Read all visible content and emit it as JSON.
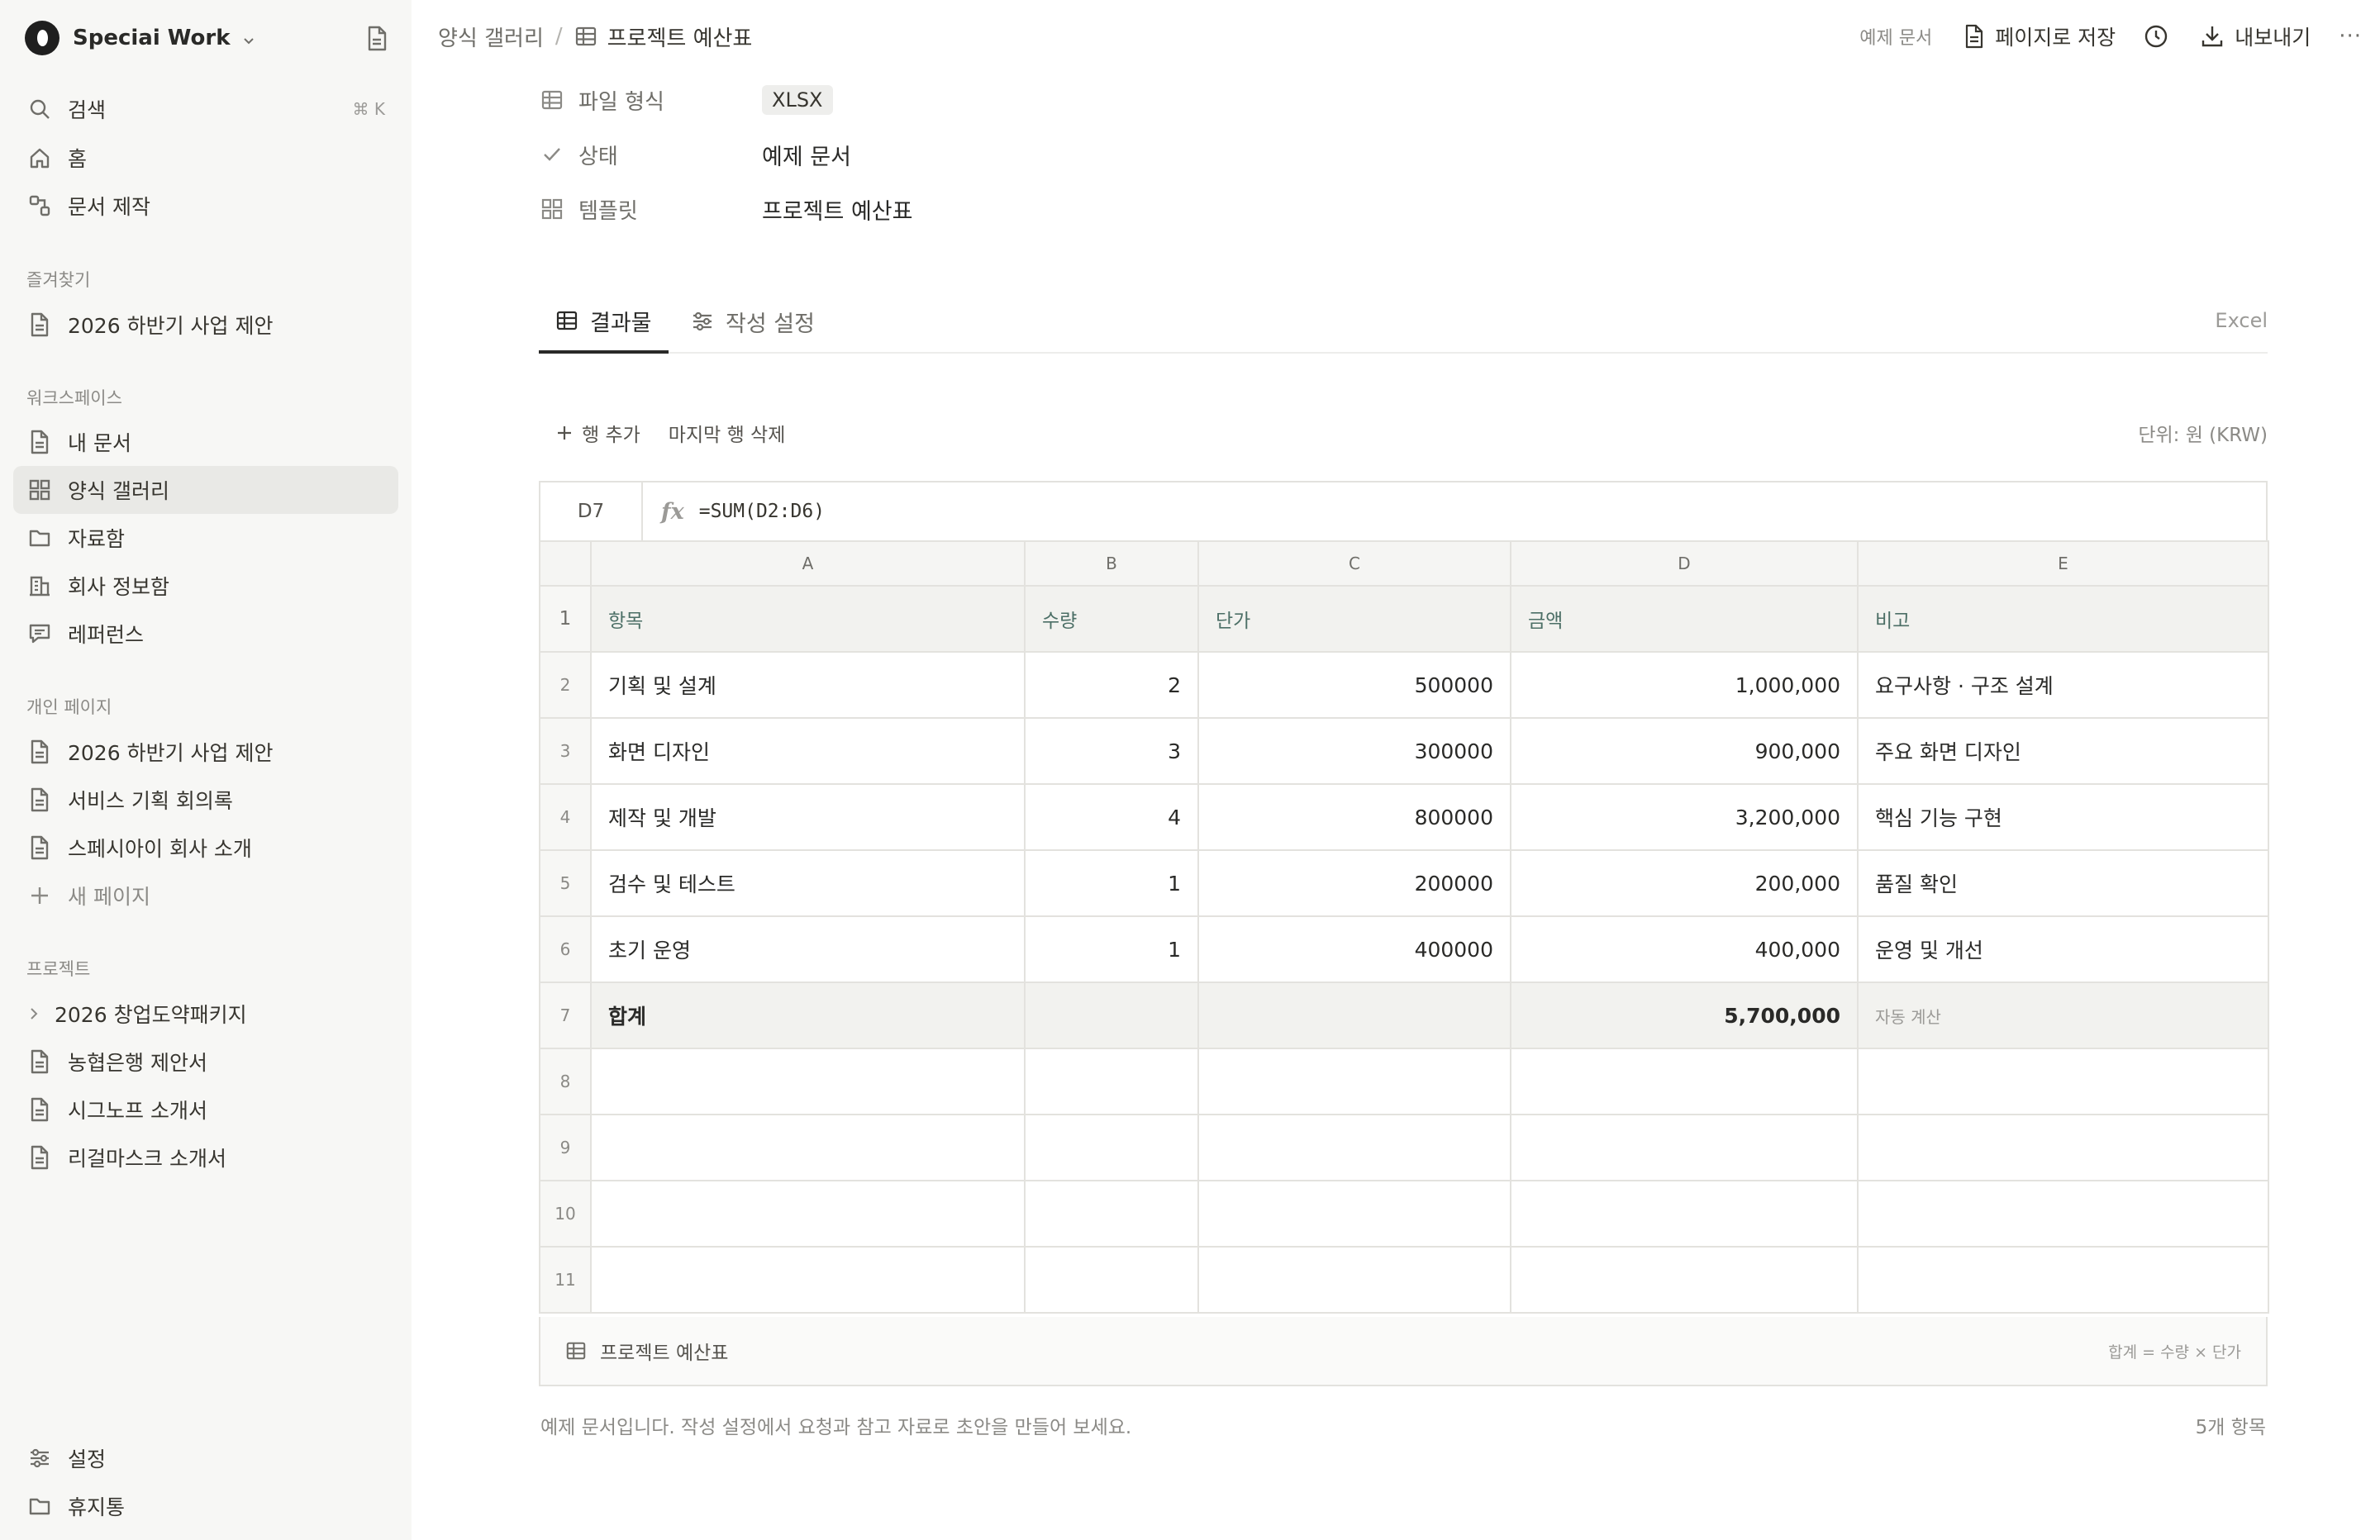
{
  "sidebar": {
    "workspace_name": "Speciai Work",
    "search": {
      "label": "검색",
      "shortcut": "⌘ K"
    },
    "top_items": [
      {
        "label": "홈"
      },
      {
        "label": "문서 제작"
      }
    ],
    "favorites": {
      "title": "즐겨찾기",
      "items": [
        {
          "label": "2026 하반기 사업 제안"
        }
      ]
    },
    "workspace": {
      "title": "워크스페이스",
      "items": [
        {
          "label": "내 문서"
        },
        {
          "label": "양식 갤러리",
          "active": true
        },
        {
          "label": "자료함"
        },
        {
          "label": "회사 정보함"
        },
        {
          "label": "레퍼런스"
        }
      ]
    },
    "personal": {
      "title": "개인 페이지",
      "items": [
        {
          "label": "2026 하반기 사업 제안"
        },
        {
          "label": "서비스 기획 회의록"
        },
        {
          "label": "스페시아이 회사 소개"
        }
      ],
      "new_page": "새 페이지"
    },
    "projects": {
      "title": "프로젝트",
      "items": [
        {
          "label": "2026 창업도약패키지"
        },
        {
          "label": "농협은행 제안서"
        },
        {
          "label": "시그노프 소개서"
        },
        {
          "label": "리걸마스크 소개서"
        }
      ]
    },
    "bottom": {
      "settings": "설정",
      "trash": "휴지통"
    }
  },
  "topbar": {
    "breadcrumb_parent": "양식 갤러리",
    "breadcrumb_sep": "/",
    "breadcrumb_current": "프로젝트 예산표",
    "sample_label": "예제 문서",
    "save_as_page": "페이지로 저장",
    "export": "내보내기",
    "more": "···"
  },
  "properties": {
    "file_format": {
      "label": "파일 형식",
      "value": "XLSX"
    },
    "status": {
      "label": "상태",
      "value": "예제 문서"
    },
    "template": {
      "label": "템플릿",
      "value": "프로젝트 예산표"
    }
  },
  "tabs": {
    "result": "결과물",
    "settings": "작성 설정",
    "right_label": "Excel"
  },
  "toolbar": {
    "add_row": "행 추가",
    "delete_last_row": "마지막 행 삭제",
    "unit": "단위: 원 (KRW)"
  },
  "formula_bar": {
    "cell_ref": "D7",
    "fx": "fx",
    "formula": "=SUM(D2:D6)"
  },
  "sheet": {
    "columns": [
      "A",
      "B",
      "C",
      "D",
      "E"
    ],
    "header_row": {
      "n": "1",
      "cells": [
        "항목",
        "수량",
        "단가",
        "금액",
        "비고"
      ]
    },
    "rows": [
      {
        "n": "2",
        "item": "기획 및 설계",
        "qty": "2",
        "price": "500000",
        "amount": "1,000,000",
        "note": "요구사항 · 구조 설계"
      },
      {
        "n": "3",
        "item": "화면 디자인",
        "qty": "3",
        "price": "300000",
        "amount": "900,000",
        "note": "주요 화면 디자인"
      },
      {
        "n": "4",
        "item": "제작 및 개발",
        "qty": "4",
        "price": "800000",
        "amount": "3,200,000",
        "note": "핵심 기능 구현"
      },
      {
        "n": "5",
        "item": "검수 및 테스트",
        "qty": "1",
        "price": "200000",
        "amount": "200,000",
        "note": "품질 확인"
      },
      {
        "n": "6",
        "item": "초기 운영",
        "qty": "1",
        "price": "400000",
        "amount": "400,000",
        "note": "운영 및 개선"
      }
    ],
    "total_row": {
      "n": "7",
      "label": "합계",
      "amount": "5,700,000",
      "note": "자동 계산"
    },
    "empty_rows": [
      "8",
      "9",
      "10",
      "11"
    ],
    "sheet_name": "프로젝트 예산표",
    "footer_hint": "합계 = 수량 × 단가"
  },
  "caption": "예제 문서입니다. 작성 설정에서 요청과 참고 자료로 초안을 만들어 보세요.",
  "item_count": "5개 항목"
}
